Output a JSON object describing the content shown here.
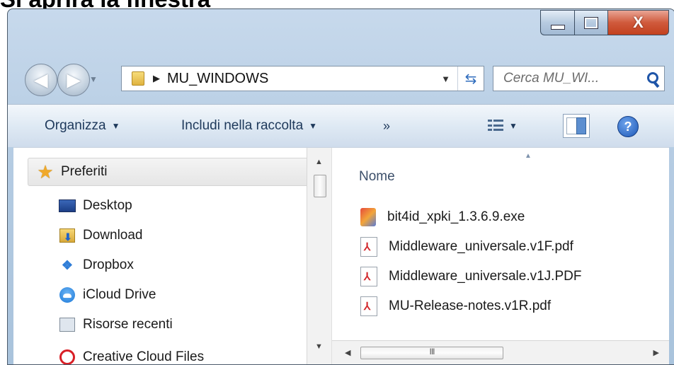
{
  "page_heading": "Si aprirà la finestra",
  "window": {
    "caption": {
      "minimize_icon": "minimize-icon",
      "maximize_icon": "maximize-icon",
      "close_glyph": "X"
    },
    "address_bar": {
      "separator_glyph": "▶",
      "path": "MU_WINDOWS",
      "dropdown_glyph": "▼",
      "refresh_glyph": "⇆"
    },
    "search": {
      "placeholder": "Cerca MU_WI..."
    },
    "command_bar": {
      "organize_label": "Organizza",
      "include_label": "Includi nella raccolta",
      "more_label": "»",
      "caret": "▼",
      "help_glyph": "?"
    },
    "nav_pane": {
      "items": [
        {
          "label": "Preferiti",
          "icon": "star-icon"
        },
        {
          "label": "Desktop",
          "icon": "desktop-icon"
        },
        {
          "label": "Download",
          "icon": "download-folder-icon"
        },
        {
          "label": "Dropbox",
          "icon": "dropbox-icon"
        },
        {
          "label": "iCloud Drive",
          "icon": "icloud-icon"
        },
        {
          "label": "Risorse recenti",
          "icon": "recent-places-icon"
        },
        {
          "label": "Creative Cloud Files",
          "icon": "creative-cloud-icon"
        }
      ]
    },
    "file_list": {
      "column_name": "Nome",
      "files": [
        {
          "name": "bit4id_xpki_1.3.6.9.exe",
          "icon": "exe-icon"
        },
        {
          "name": "Middleware_universale.v1F.pdf",
          "icon": "pdf-icon"
        },
        {
          "name": "Middleware_universale.v1J.PDF",
          "icon": "pdf-icon"
        },
        {
          "name": "MU-Release-notes.v1R.pdf",
          "icon": "pdf-icon"
        }
      ]
    },
    "scrollbar": {
      "thumb_grip": "III"
    }
  },
  "colors": {
    "frame": "#b4cbe2",
    "command_bar": "#dde8f3",
    "close_button": "#c2401e",
    "text_link": "#1e395b"
  }
}
